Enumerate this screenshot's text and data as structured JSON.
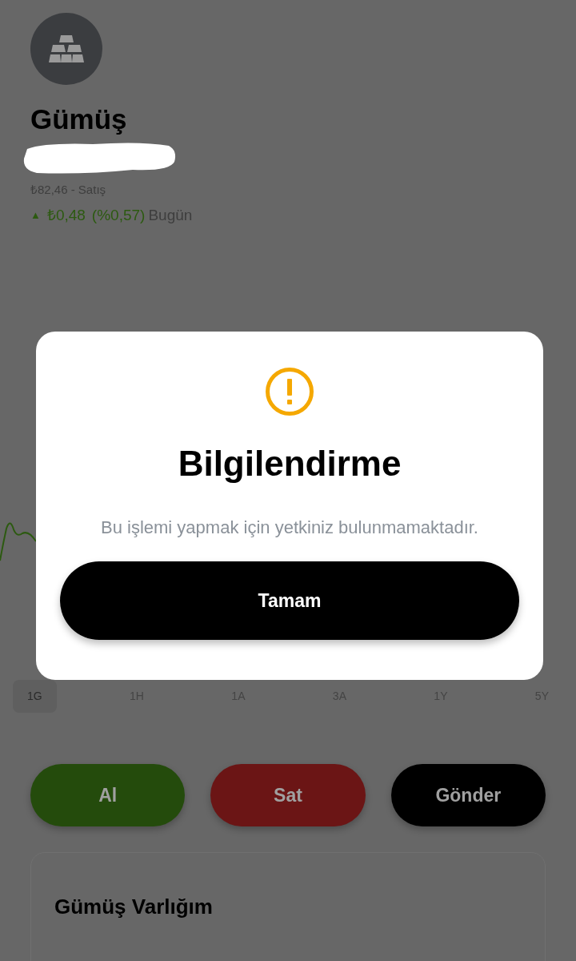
{
  "asset": {
    "name": "Gümüş",
    "sell_price": "₺82,46 - Satış",
    "change": {
      "arrow": "▲",
      "amount": "₺0,48",
      "percent": "(%0,57)",
      "period": "Bugün"
    }
  },
  "timeframes": [
    {
      "label": "1G",
      "selected": true
    },
    {
      "label": "1H",
      "selected": false
    },
    {
      "label": "1A",
      "selected": false
    },
    {
      "label": "3A",
      "selected": false
    },
    {
      "label": "1Y",
      "selected": false
    },
    {
      "label": "5Y",
      "selected": false
    }
  ],
  "actions": [
    {
      "label": "Al",
      "color": "#244b0c"
    },
    {
      "label": "Sat",
      "color": "#6b1515"
    },
    {
      "label": "Gönder",
      "color": "#000000"
    }
  ],
  "holdings_card": {
    "title": "Gümüş Varlığım"
  },
  "dialog": {
    "title": "Bilgilendirme",
    "message": "Bu işlemi yapmak için yetkiniz bulunmamaktadır.",
    "button": "Tamam"
  }
}
